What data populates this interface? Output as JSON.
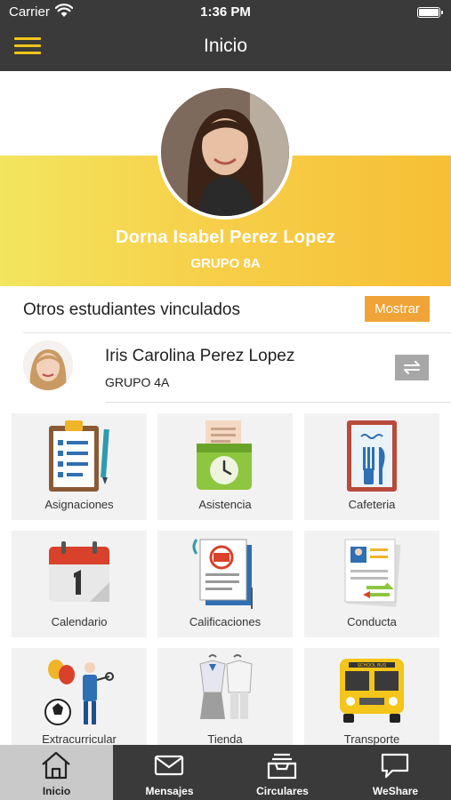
{
  "status_bar": {
    "carrier": "Carrier",
    "time": "1:36 PM"
  },
  "nav": {
    "title": "Inicio",
    "menu_icon": "hamburger-icon"
  },
  "student": {
    "name": "Dorna Isabel Perez Lopez",
    "group": "GRUPO 8A"
  },
  "linked": {
    "title": "Otros estudiantes vinculados",
    "show_label": "Mostrar",
    "students": [
      {
        "name": "Iris Carolina Perez Lopez",
        "group": "GRUPO 4A"
      }
    ]
  },
  "menu_tiles": [
    {
      "label": "Asignaciones",
      "icon": "clipboard-checklist-icon"
    },
    {
      "label": "Asistencia",
      "icon": "attendance-clock-icon"
    },
    {
      "label": "Cafeteria",
      "icon": "cafeteria-menu-icon"
    },
    {
      "label": "Calendario",
      "icon": "calendar-icon"
    },
    {
      "label": "Calificaciones",
      "icon": "grade-report-icon"
    },
    {
      "label": "Conducta",
      "icon": "conduct-report-icon"
    },
    {
      "label": "Extracurricular",
      "icon": "extracurricular-icon"
    },
    {
      "label": "Tienda",
      "icon": "uniform-store-icon"
    },
    {
      "label": "Transporte",
      "icon": "school-bus-icon"
    }
  ],
  "tabs": [
    {
      "label": "Inicio",
      "icon": "home-icon",
      "active": true
    },
    {
      "label": "Mensajes",
      "icon": "envelope-icon",
      "active": false
    },
    {
      "label": "Circulares",
      "icon": "inbox-tray-icon",
      "active": false
    },
    {
      "label": "WeShare",
      "icon": "chat-bubble-icon",
      "active": false
    }
  ],
  "colors": {
    "bar": "#3a3a3a",
    "accent": "#f4c51a",
    "button": "#f0a336",
    "tile": "#f2f2f2"
  },
  "bus_sign": "SCHOOL BUS"
}
